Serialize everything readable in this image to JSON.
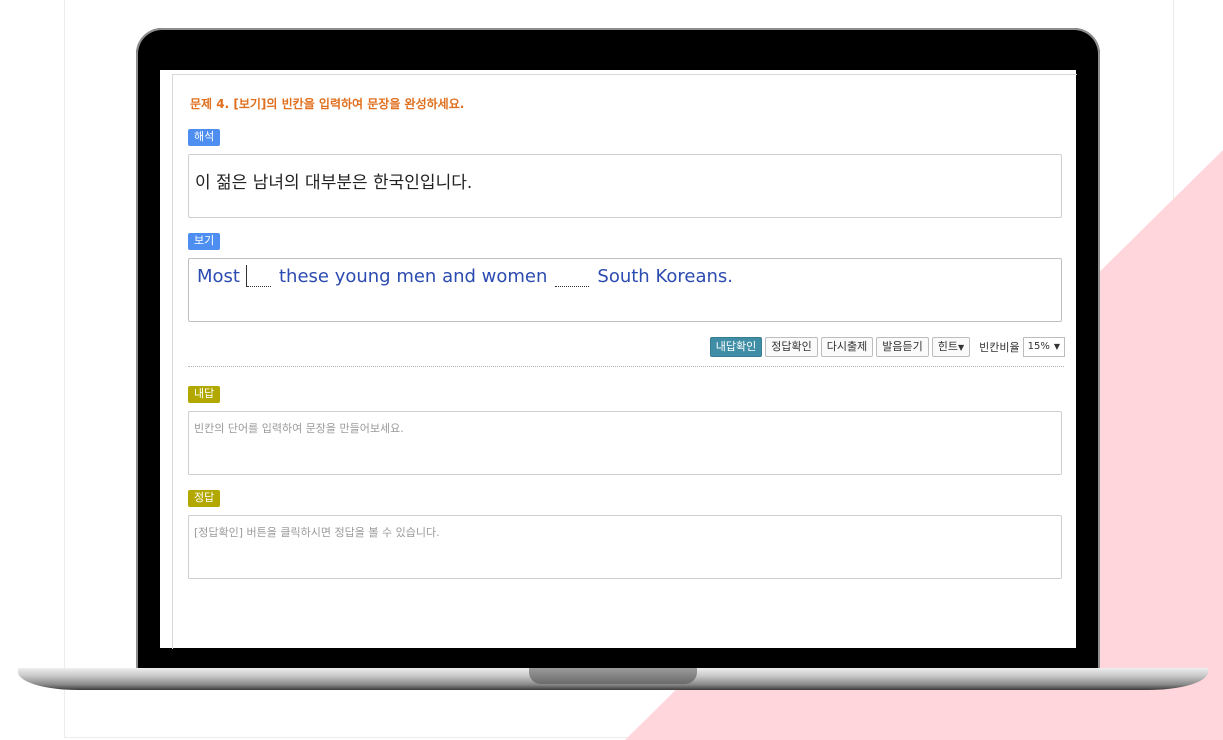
{
  "question": {
    "title": "문제 4. [보기]의 빈칸을 입력하여 문장을 완성하세요."
  },
  "translation": {
    "badge": "해석",
    "text": "이 젊은 남녀의 대부분은 한국인입니다."
  },
  "example": {
    "badge": "보기",
    "word1": "Most",
    "word2": "these young men and women",
    "word3": "South Koreans."
  },
  "toolbar": {
    "my_answer_check": "내답확인",
    "answer_check": "정답확인",
    "retry": "다시출제",
    "listen": "발음듣기",
    "hint": "힌트",
    "ratio_label": "빈칸비율",
    "ratio_value": "15%"
  },
  "my_answer": {
    "badge": "내답",
    "placeholder": "빈칸의 단어를 입력하여 문장을 만들어보세요."
  },
  "correct_answer": {
    "badge": "정답",
    "placeholder": "[정답확인] 버튼을 클릭하시면 정답을 볼 수 있습니다."
  },
  "colors": {
    "title": "#e0701f",
    "blue_badge": "#4e8ef0",
    "olive_badge": "#b2a800",
    "sentence": "#2c4bb0",
    "primary_button": "#3f8ea6",
    "decoration": "#ffd6dc"
  },
  "icons": {
    "dropdown": "chevron-down-icon"
  }
}
